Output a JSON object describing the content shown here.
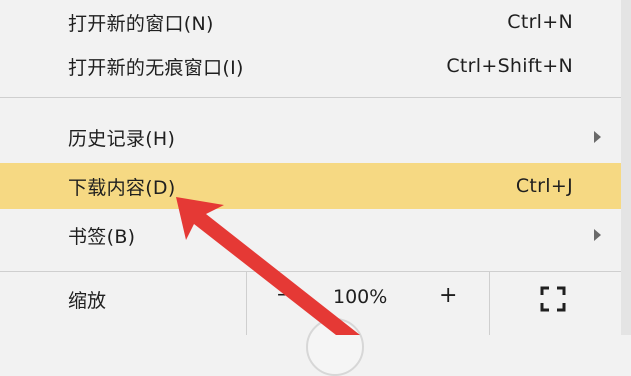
{
  "menu": {
    "items": [
      {
        "label": "打开新的窗口(N)",
        "shortcut": "Ctrl+N"
      },
      {
        "label": "打开新的无痕窗口(I)",
        "shortcut": "Ctrl+Shift+N"
      },
      {
        "label": "历史记录(H)",
        "submenu": true
      },
      {
        "label": "下载内容(D)",
        "shortcut": "Ctrl+J",
        "highlighted": true
      },
      {
        "label": "书签(B)",
        "submenu": true
      }
    ],
    "zoom": {
      "label": "缩放",
      "minus": "–",
      "value": "100%",
      "plus": "+",
      "fullscreen_icon": "fullscreen-icon"
    }
  },
  "colors": {
    "highlight": "#f6d983",
    "annotation_arrow": "#e53935",
    "background": "#f2f2f2"
  }
}
